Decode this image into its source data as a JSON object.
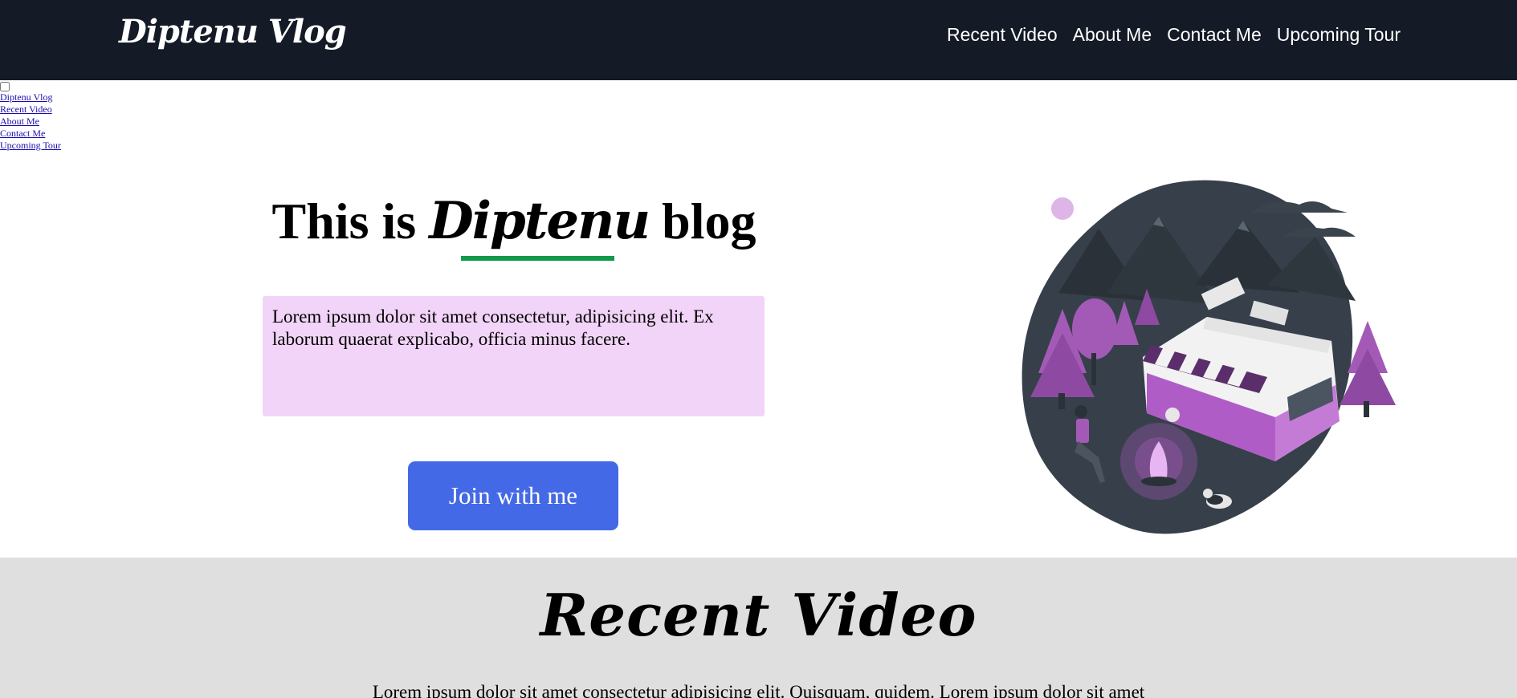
{
  "nav": {
    "brand": "Diptenu Vlog",
    "links": [
      "Recent Video",
      "About Me",
      "Contact Me",
      "Upcoming Tour"
    ]
  },
  "fallback_menu": {
    "links": [
      "Diptenu Vlog",
      "Recent Video",
      "About Me",
      "Contact Me",
      "Upcoming Tour"
    ]
  },
  "hero": {
    "title_prefix": "This is ",
    "title_accent": "Diptenu",
    "title_suffix": " blog",
    "lead": "Lorem ipsum dolor sit amet consectetur, adipisicing elit. Ex laborum quaerat explicabo, officia minus facere.",
    "button_label": "Join with me"
  },
  "recent_video": {
    "title": "Recent Video",
    "text": "Lorem ipsum dolor sit amet consectetur adipisicing elit. Quisquam, quidem. Lorem ipsum dolor sit amet"
  },
  "colors": {
    "nav_bg": "#141b26",
    "accent_underline": "#12994a",
    "lead_box_bg": "#f2d4f8",
    "button_bg": "#4469e6",
    "section_bg": "#dfdfdf",
    "illustration_purple": "#a35ab6"
  }
}
